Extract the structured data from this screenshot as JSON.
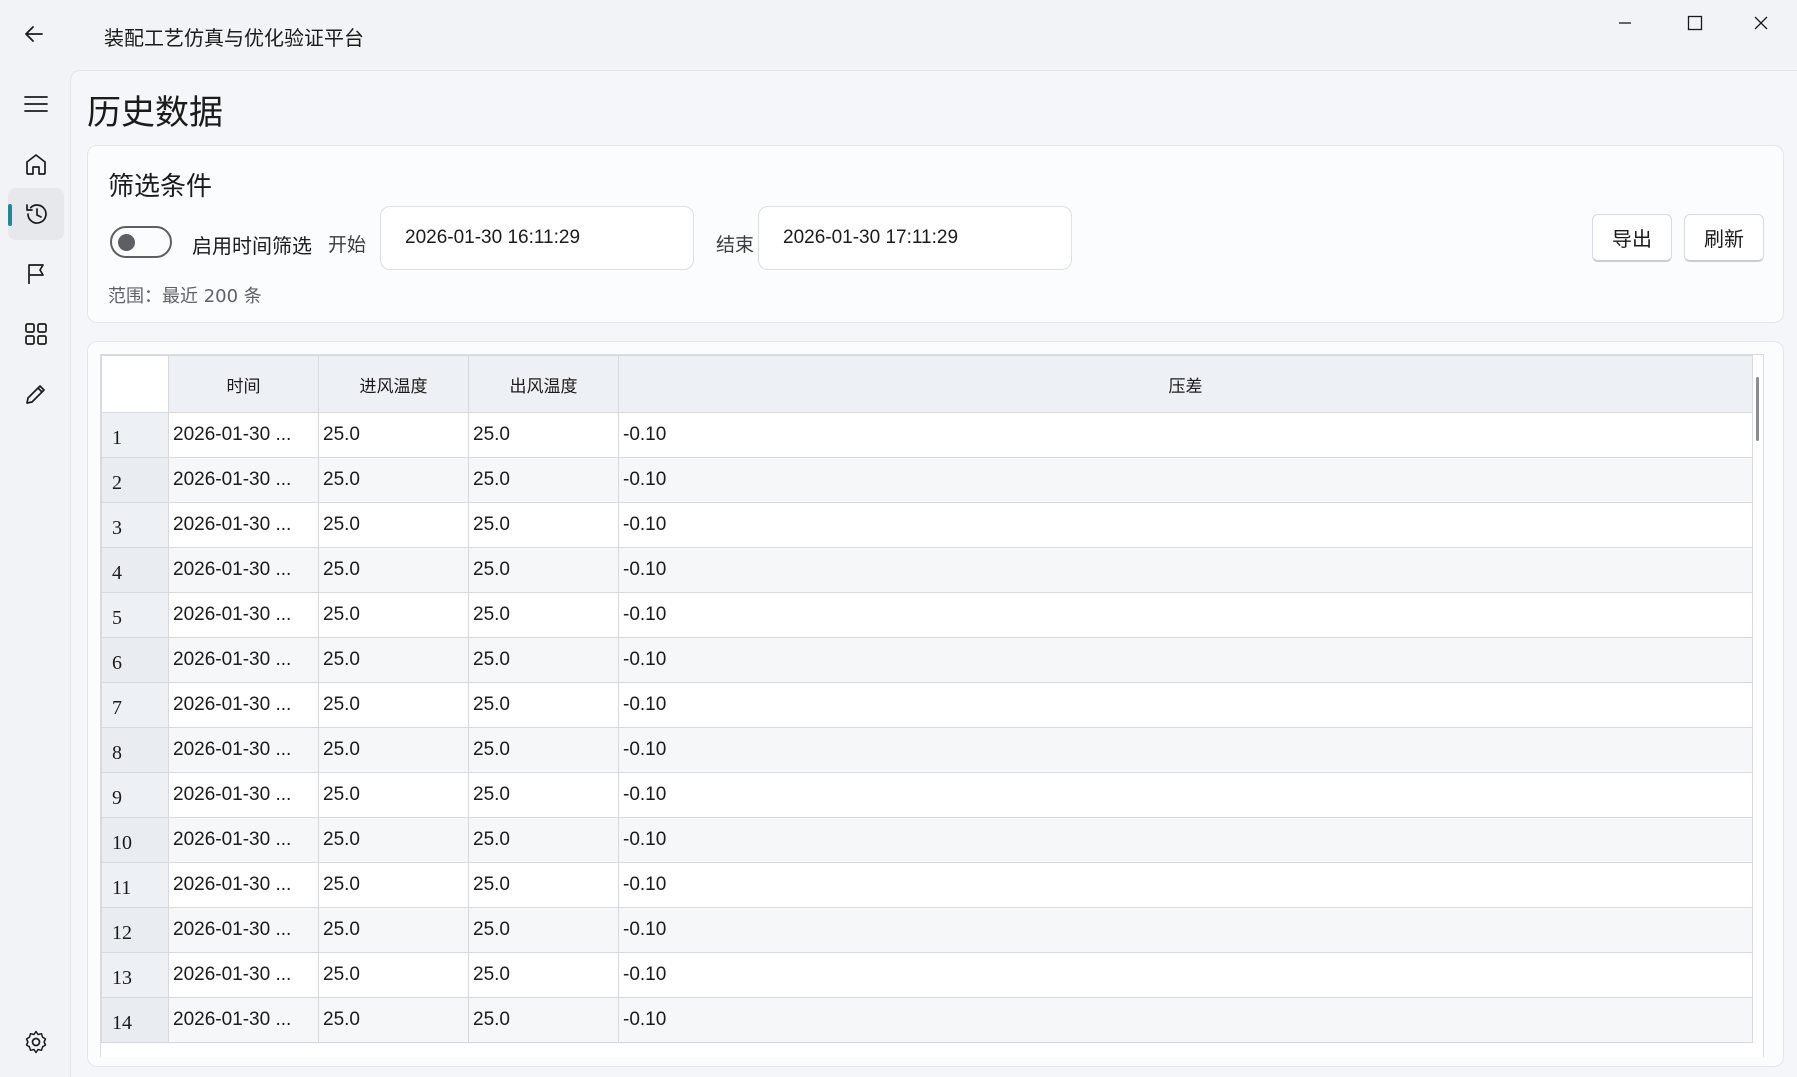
{
  "app": {
    "title": "装配工艺仿真与优化验证平台"
  },
  "sidebar": {
    "items": [
      {
        "icon": "menu-icon"
      },
      {
        "icon": "home-icon"
      },
      {
        "icon": "history-icon",
        "active": true
      },
      {
        "icon": "flag-icon"
      },
      {
        "icon": "apps-icon"
      },
      {
        "icon": "edit-icon"
      },
      {
        "icon": "settings-icon"
      }
    ]
  },
  "page": {
    "title": "历史数据"
  },
  "filter": {
    "title": "筛选条件",
    "toggle_label": "启用时间筛选",
    "toggle_on": false,
    "start_label": "开始",
    "start_value": "2026-01-30 16:11:29",
    "end_label": "结束",
    "end_value": "2026-01-30 17:11:29",
    "export_label": "导出",
    "refresh_label": "刷新",
    "range_text": "范围：最近 200 条"
  },
  "table": {
    "columns": [
      "时间",
      "进风温度",
      "出风温度",
      "压差"
    ],
    "rows": [
      [
        "1",
        "2026-01-30 ...",
        "25.0",
        "25.0",
        "-0.10"
      ],
      [
        "2",
        "2026-01-30 ...",
        "25.0",
        "25.0",
        "-0.10"
      ],
      [
        "3",
        "2026-01-30 ...",
        "25.0",
        "25.0",
        "-0.10"
      ],
      [
        "4",
        "2026-01-30 ...",
        "25.0",
        "25.0",
        "-0.10"
      ],
      [
        "5",
        "2026-01-30 ...",
        "25.0",
        "25.0",
        "-0.10"
      ],
      [
        "6",
        "2026-01-30 ...",
        "25.0",
        "25.0",
        "-0.10"
      ],
      [
        "7",
        "2026-01-30 ...",
        "25.0",
        "25.0",
        "-0.10"
      ],
      [
        "8",
        "2026-01-30 ...",
        "25.0",
        "25.0",
        "-0.10"
      ],
      [
        "9",
        "2026-01-30 ...",
        "25.0",
        "25.0",
        "-0.10"
      ],
      [
        "10",
        "2026-01-30 ...",
        "25.0",
        "25.0",
        "-0.10"
      ],
      [
        "11",
        "2026-01-30 ...",
        "25.0",
        "25.0",
        "-0.10"
      ],
      [
        "12",
        "2026-01-30 ...",
        "25.0",
        "25.0",
        "-0.10"
      ],
      [
        "13",
        "2026-01-30 ...",
        "25.0",
        "25.0",
        "-0.10"
      ],
      [
        "14",
        "2026-01-30 ...",
        "25.0",
        "25.0",
        "-0.10"
      ]
    ]
  },
  "colors": {
    "accent": "#1e8a8f"
  }
}
